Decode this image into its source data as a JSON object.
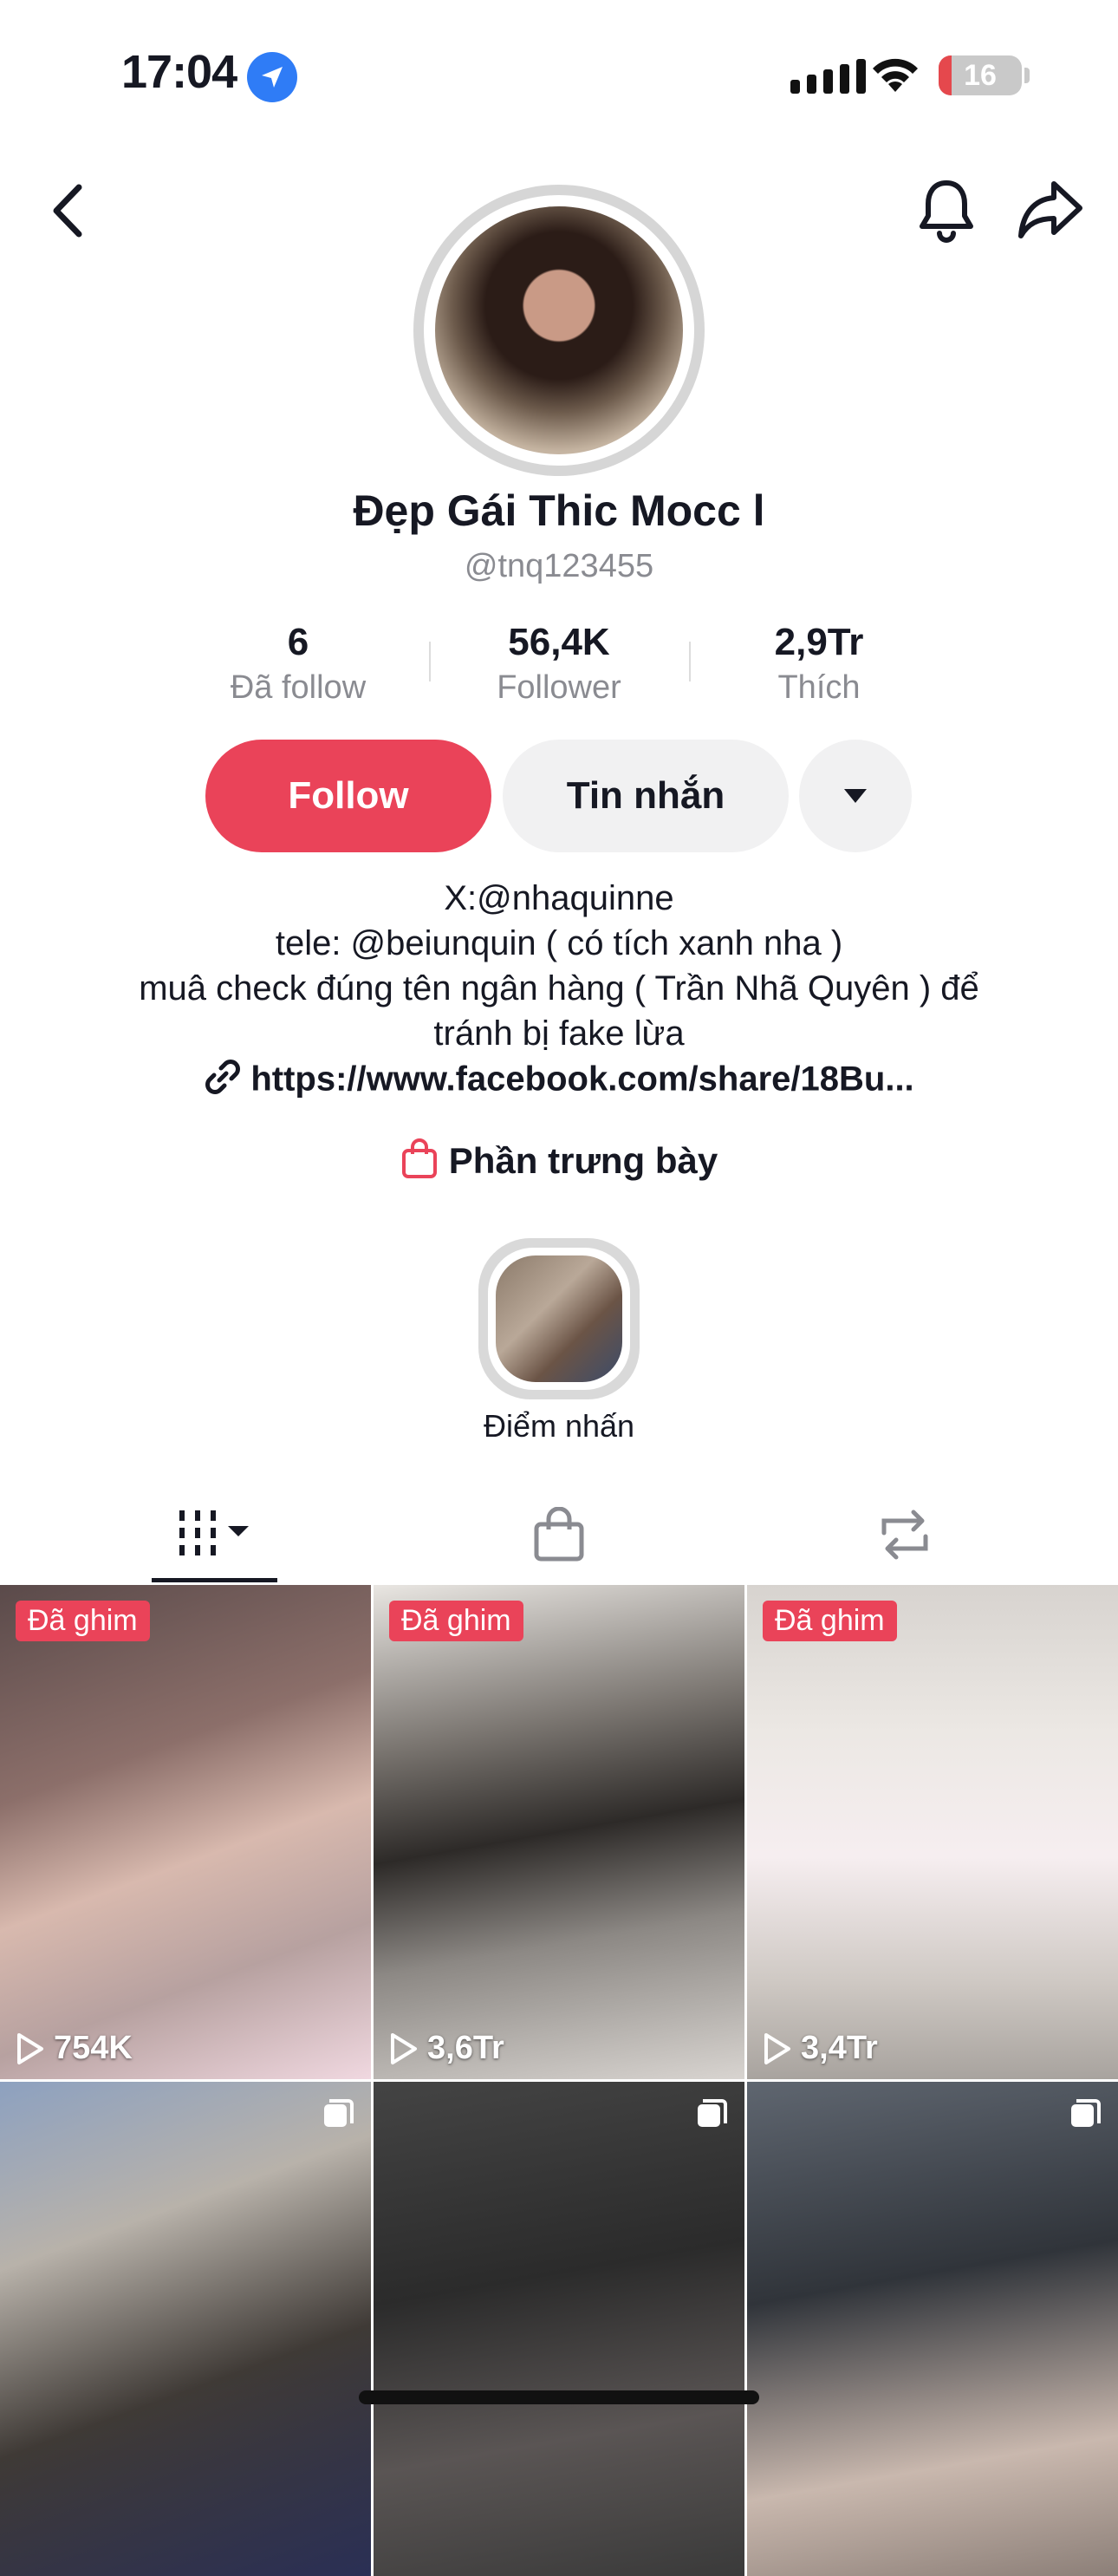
{
  "status_bar": {
    "time": "17:04",
    "battery": "16"
  },
  "profile": {
    "display_name": "Đẹp Gái Thic Mocc l",
    "username": "@tnq123455"
  },
  "stats": [
    {
      "value": "6",
      "label": "Đã follow"
    },
    {
      "value": "56,4K",
      "label": "Follower"
    },
    {
      "value": "2,9Tr",
      "label": "Thích"
    }
  ],
  "actions": {
    "follow": "Follow",
    "message": "Tin nhắn"
  },
  "bio": {
    "lines": [
      "X:@nhaquinne",
      "tele: @beiunquin ( có tích xanh nha )",
      "muâ check đúng tên ngân hàng ( Trần Nhã Quyên ) để",
      "tránh bị fake lừa"
    ],
    "link": "https://www.facebook.com/share/18Bu..."
  },
  "showcase": "Phần trưng bày",
  "highlight": {
    "label": "Điểm nhấn"
  },
  "colors": {
    "accent": "#ea4359",
    "muted_text": "#8a8b91",
    "chip_bg": "#f1f1f2"
  },
  "videos": [
    {
      "pinned": "Đã ghim",
      "views": "754K"
    },
    {
      "pinned": "Đã ghim",
      "views": "3,6Tr"
    },
    {
      "pinned": "Đã ghim",
      "views": "3,4Tr"
    },
    {
      "icon": "multi-image-icon"
    },
    {
      "icon": "multi-image-icon"
    },
    {
      "icon": "multi-image-icon"
    }
  ]
}
